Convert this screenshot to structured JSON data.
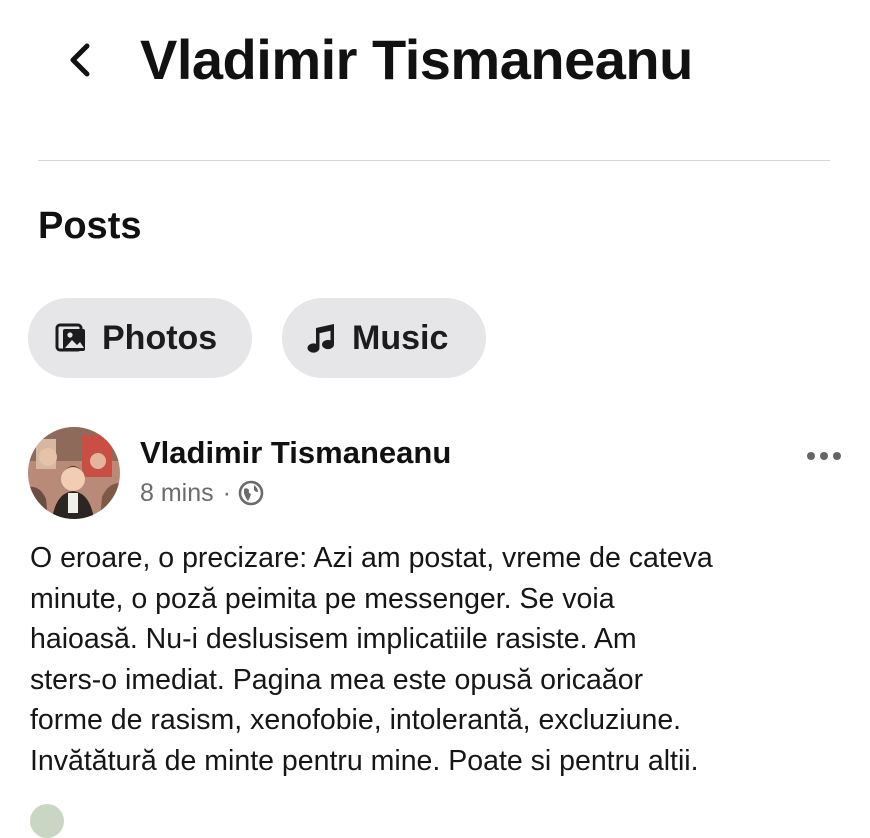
{
  "header": {
    "title": "Vladimir Tismaneanu",
    "back_icon": "chevron-left-icon"
  },
  "section": {
    "title": "Posts"
  },
  "filters": [
    {
      "label": "Photos",
      "icon": "photos-icon"
    },
    {
      "label": "Music",
      "icon": "music-note-icon"
    }
  ],
  "post": {
    "author": "Vladimir Tismaneanu",
    "time": "8 mins",
    "separator": "·",
    "privacy_icon": "globe-icon",
    "more_icon": "more-horizontal-icon",
    "text_lines": [
      "O eroare, o precizare: Azi am postat, vreme de cateva",
      "minute, o poză peimita pe messenger. Se voia",
      "haioasă. Nu-i deslusisem implicatiile rasiste. Am",
      "sters-o imediat. Pagina mea este opusă oricaăor",
      "forme de rasism, xenofobie, intolerantă, excluziune.",
      "Invătătură de minte pentru mine. Poate si pentru altii."
    ]
  },
  "colors": {
    "chip_bg": "#e6e6e8",
    "divider": "#d6d6d6",
    "meta_text": "#6b6b6b"
  }
}
